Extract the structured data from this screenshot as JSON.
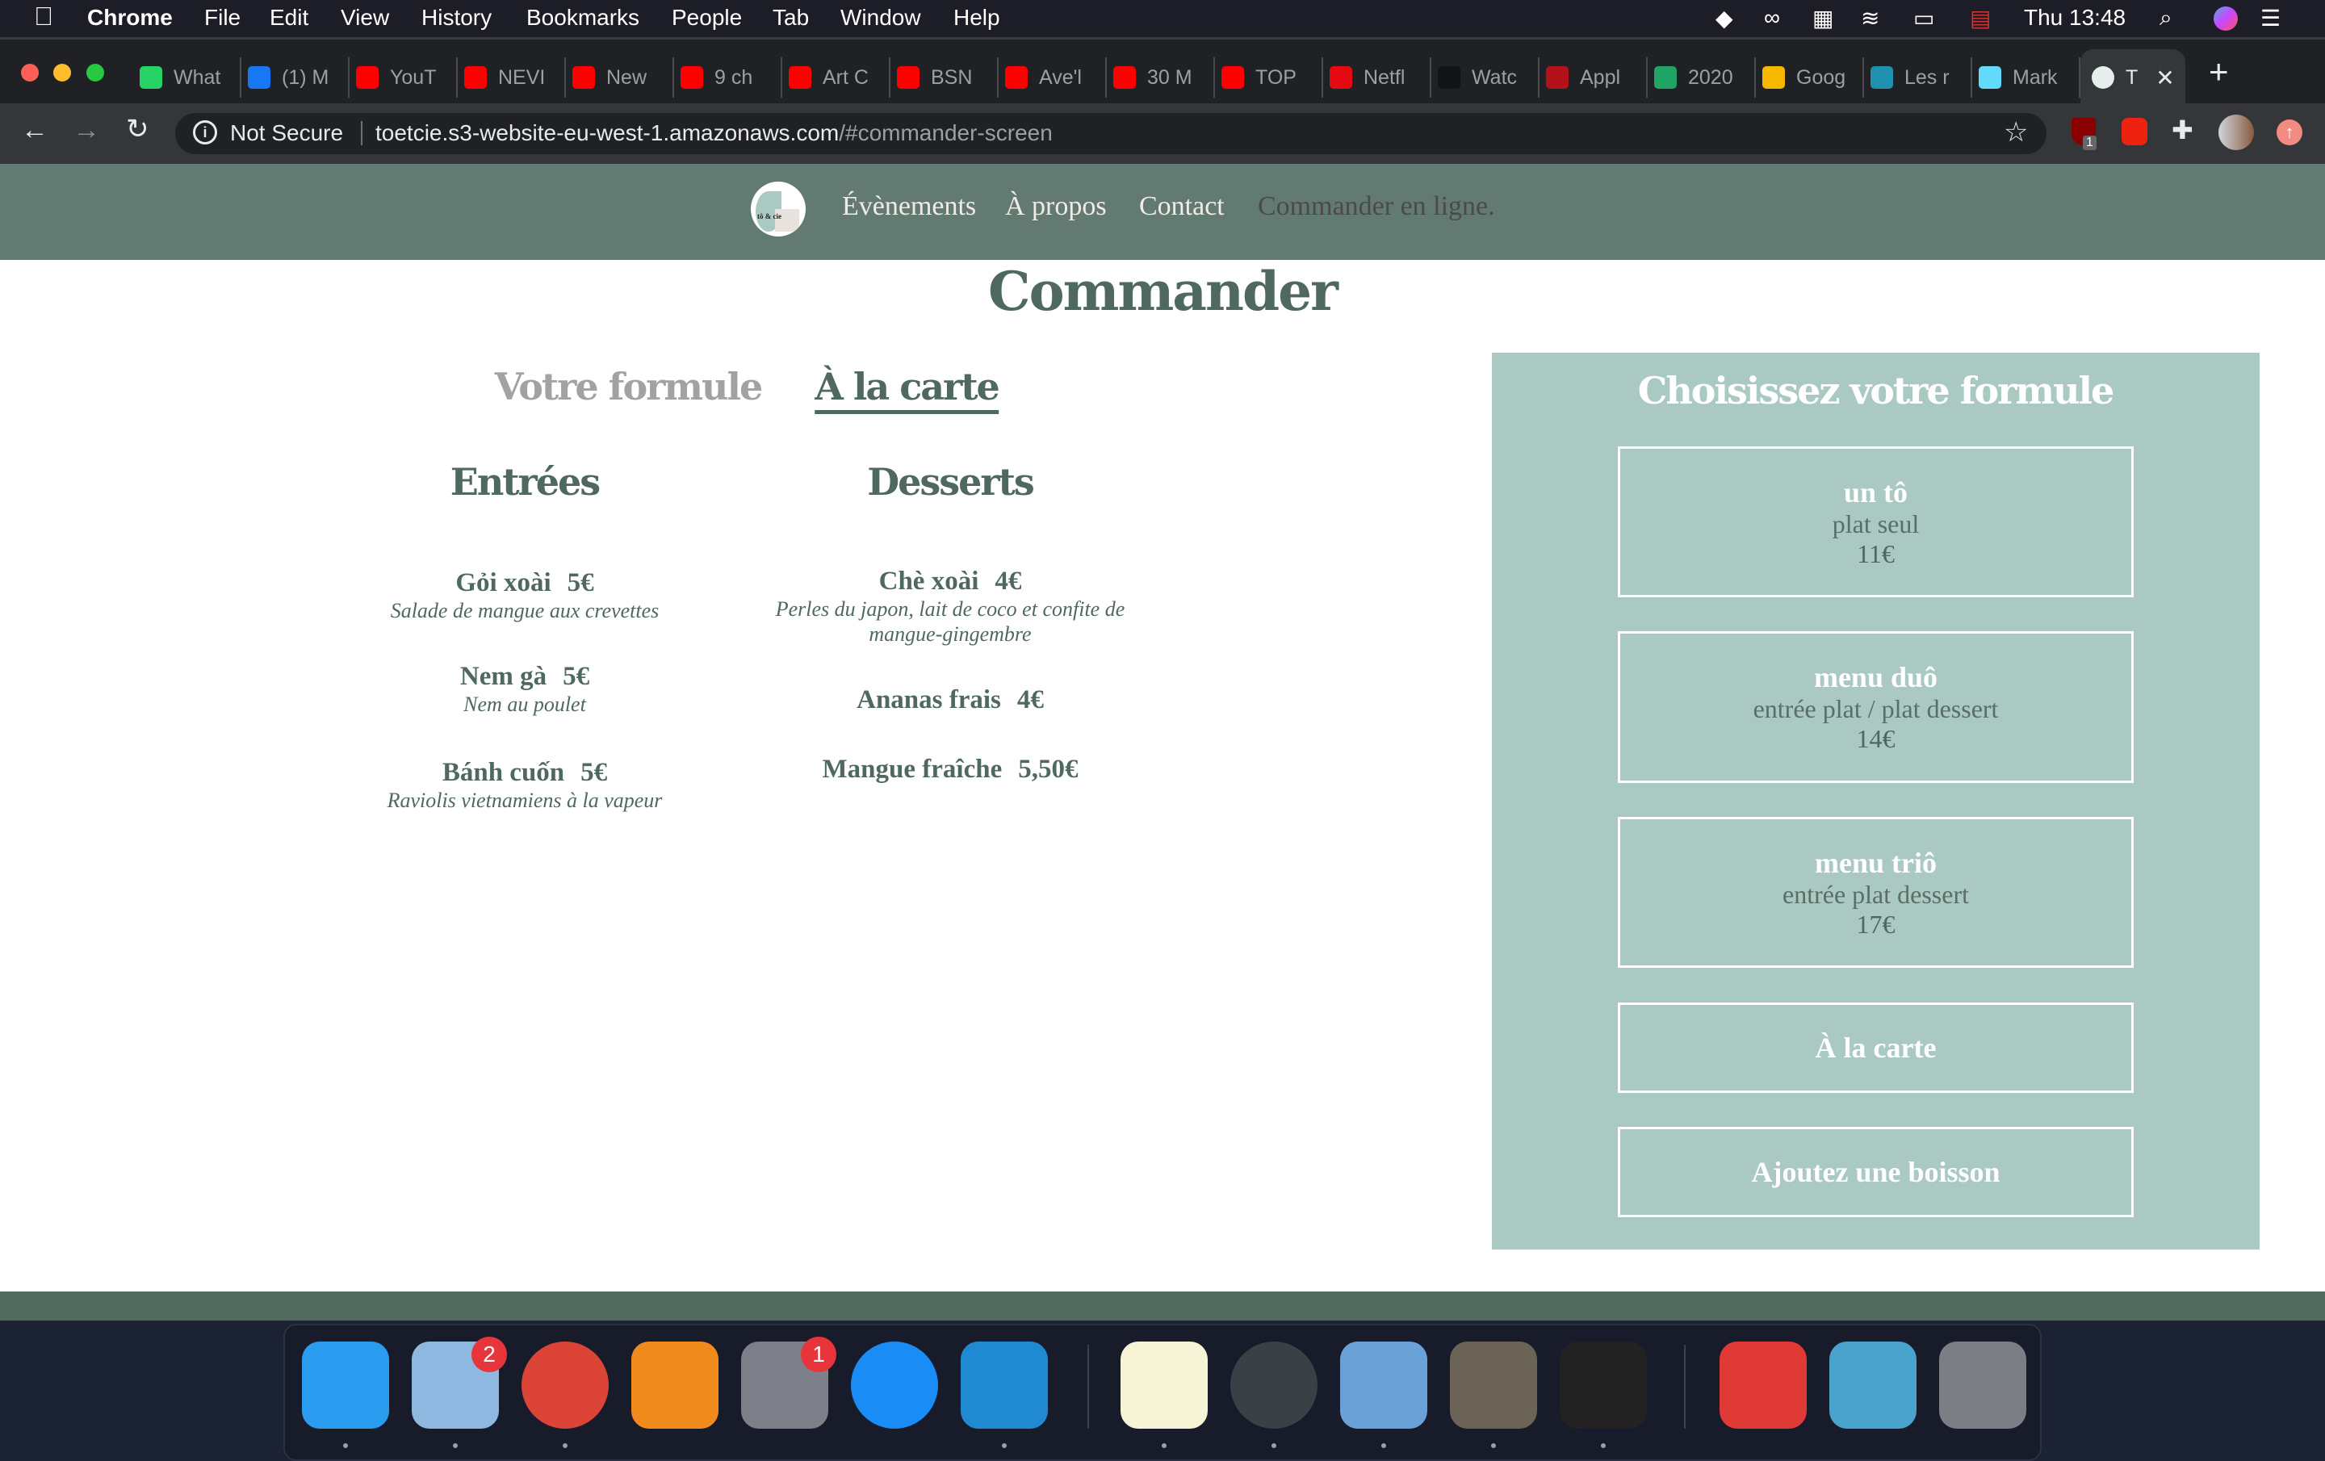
{
  "menubar": {
    "app": "Chrome",
    "items": [
      "File",
      "Edit",
      "View",
      "History",
      "Bookmarks",
      "People",
      "Tab",
      "Window",
      "Help"
    ],
    "clock": "Thu 13:48"
  },
  "tabs": [
    {
      "title": "What",
      "icon": "whatsapp-icon",
      "color": "#25d366"
    },
    {
      "title": "(1) M",
      "icon": "facebook-icon",
      "color": "#1877f2"
    },
    {
      "title": "YouT",
      "icon": "youtube-icon",
      "color": "#ff0000"
    },
    {
      "title": "NEVI",
      "icon": "youtube-icon",
      "color": "#ff0000"
    },
    {
      "title": "New",
      "icon": "youtube-icon",
      "color": "#ff0000"
    },
    {
      "title": "9 ch",
      "icon": "youtube-icon",
      "color": "#ff0000"
    },
    {
      "title": "Art C",
      "icon": "youtube-icon",
      "color": "#ff0000"
    },
    {
      "title": "BSN",
      "icon": "youtube-icon",
      "color": "#ff0000"
    },
    {
      "title": "Ave'l",
      "icon": "youtube-icon",
      "color": "#ff0000"
    },
    {
      "title": "30 M",
      "icon": "youtube-icon",
      "color": "#ff0000"
    },
    {
      "title": "TOP",
      "icon": "youtube-icon",
      "color": "#ff0000"
    },
    {
      "title": "Netfl",
      "icon": "netflix-icon",
      "color": "#e50914"
    },
    {
      "title": "Watc",
      "icon": "w-icon",
      "color": "#111418"
    },
    {
      "title": "Appl",
      "icon": "apple-red-icon",
      "color": "#b3121b"
    },
    {
      "title": "2020",
      "icon": "sheets-plus-icon",
      "color": "#1fa463"
    },
    {
      "title": "Goog",
      "icon": "keep-bulb-icon",
      "color": "#f6b900"
    },
    {
      "title": "Les r",
      "icon": "bookmark-tower-icon",
      "color": "#1e90b0"
    },
    {
      "title": "Mark",
      "icon": "react-icon",
      "color": "#61dafb"
    }
  ],
  "active_tab": {
    "title": "T"
  },
  "toolbar": {
    "security": "Not Secure",
    "url_host": "toetcie.s3-website-eu-west-1.amazonaws.com",
    "url_path": "/#commander-screen",
    "ublock_count": "1"
  },
  "site": {
    "logo_text": "tô & cie",
    "nav": [
      "Évènements",
      "À propos",
      "Contact",
      "Commander en ligne."
    ],
    "title": "Commander",
    "mode_tabs": [
      "Votre formule",
      "À la carte"
    ],
    "entrees": {
      "heading": "Entrées",
      "items": [
        {
          "name": "Gỏi xoài",
          "price": "5€",
          "desc": "Salade de mangue aux crevettes"
        },
        {
          "name": "Nem gà",
          "price": "5€",
          "desc": "Nem au poulet"
        },
        {
          "name": "Bánh cuốn",
          "price": "5€",
          "desc": "Raviolis vietnamiens à la vapeur"
        }
      ]
    },
    "desserts": {
      "heading": "Desserts",
      "items": [
        {
          "name": "Chè xoài",
          "price": "4€",
          "desc": "Perles du japon, lait de coco et confite de",
          "desc2": "mangue-gingembre"
        },
        {
          "name": "Ananas frais",
          "price": "4€"
        },
        {
          "name": "Mangue fraîche",
          "price": "5,50€"
        }
      ]
    },
    "panel": {
      "heading": "Choisissez votre formule",
      "formulas": [
        {
          "title": "un tô",
          "desc": "plat seul",
          "price": "11€"
        },
        {
          "title": "menu duô",
          "desc": "entrée plat / plat dessert",
          "price": "14€"
        },
        {
          "title": "menu triô",
          "desc": "entrée plat dessert",
          "price": "17€"
        }
      ],
      "a_la_carte": "À la carte",
      "drink": "Ajoutez une boisson"
    }
  },
  "dock": [
    {
      "name": "finder",
      "color": "#2a9cf0",
      "running": true
    },
    {
      "name": "mail",
      "color": "#8fb8e0",
      "running": true,
      "badge": "2"
    },
    {
      "name": "chrome",
      "color": "#db4437",
      "running": true
    },
    {
      "name": "vlc",
      "color": "#f08a1c",
      "running": false
    },
    {
      "name": "system-preferences",
      "color": "#7d8088",
      "running": false,
      "badge": "1"
    },
    {
      "name": "app-store",
      "color": "#1a8cf5",
      "running": false
    },
    {
      "name": "vscode",
      "color": "#1f8ad2",
      "running": true
    },
    {
      "name": "notes",
      "color": "#f7f3d6",
      "running": true
    },
    {
      "name": "digital-color-meter",
      "color": "#3b3f46",
      "running": true
    },
    {
      "name": "preview",
      "color": "#6aa2d8",
      "running": true
    },
    {
      "name": "gimp",
      "color": "#6b6456",
      "running": true
    },
    {
      "name": "terminal",
      "color": "#222",
      "running": true
    },
    {
      "name": "creative-cloud-folder",
      "color": "#e03a36",
      "running": false
    },
    {
      "name": "folder",
      "color": "#4aa3cc",
      "running": false
    },
    {
      "name": "trash",
      "color": "#7b7f85",
      "running": false
    }
  ]
}
